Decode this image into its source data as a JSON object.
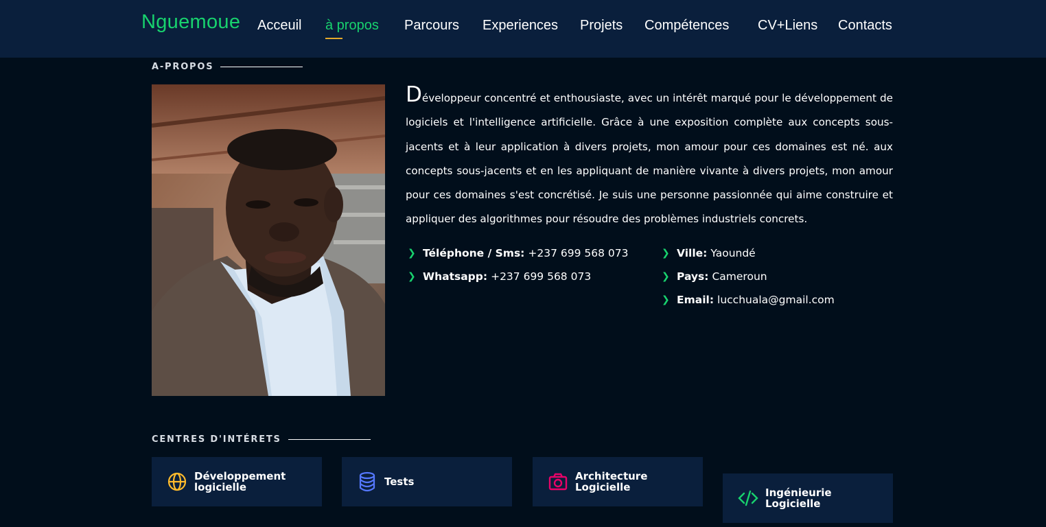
{
  "header": {
    "logo": "Nguemoue",
    "nav": [
      {
        "label": "Acceuil",
        "active": false
      },
      {
        "label": "à propos",
        "active": true
      },
      {
        "label": "Parcours",
        "active": false
      },
      {
        "label": "Experiences",
        "active": false
      },
      {
        "label": "Projets",
        "active": false
      },
      {
        "label": "Compétences",
        "active": false
      },
      {
        "label": "CV+Liens",
        "active": false
      },
      {
        "label": "Contacts",
        "active": false
      }
    ]
  },
  "about": {
    "section_title": "A-PROPOS",
    "bio_dropcap": "D",
    "bio_text": "éveloppeur concentré et enthousiaste, avec un intérêt marqué pour le développement de logiciels et l'intelligence artificielle. Grâce à une exposition complète aux concepts sous-jacents et à leur application à divers projets, mon amour pour ces domaines est né. aux concepts sous-jacents et en les appliquant de manière vivante à divers projets, mon amour pour ces domaines s'est concrétisé. Je suis une personne passionnée qui aime construire et appliquer des algorithmes pour résoudre des problèmes industriels concrets.",
    "info_left": [
      {
        "label": "Téléphone / Sms:",
        "value": "+237 699 568 073"
      },
      {
        "label": "Whatsapp:",
        "value": "+237 699 568 073"
      }
    ],
    "info_right": [
      {
        "label": "Ville:",
        "value": "Yaoundé"
      },
      {
        "label": "Pays:",
        "value": "Cameroun"
      },
      {
        "label": "Email:",
        "value": "lucchuala@gmail.com"
      }
    ],
    "bullet_icon": "chevron-right-icon"
  },
  "interests": {
    "section_title": "CENTRES D'INTÉRETS",
    "cards": [
      {
        "label": "Développement logicielle",
        "icon": "globe-icon",
        "color": "#ffbb2c"
      },
      {
        "label": "Tests",
        "icon": "database-icon",
        "color": "#5578ff"
      },
      {
        "label": "Architecture Logicielle",
        "icon": "camera-icon",
        "color": "#e80368"
      },
      {
        "label": "Ingénieurie Logicielle",
        "icon": "code-icon",
        "color": "#11dbcf"
      }
    ]
  },
  "colors": {
    "accent": "#18d26e",
    "header_bg": "#0a1f3c",
    "page_bg": "#010e1b",
    "underline": "#e5a92b"
  }
}
